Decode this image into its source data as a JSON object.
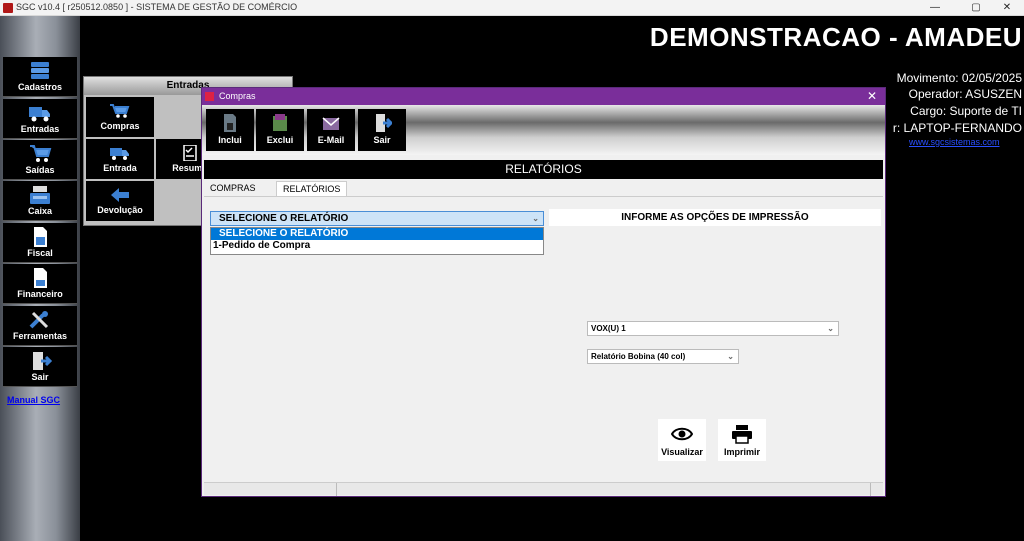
{
  "window": {
    "title": "SGC v10.4 [ r250512.0850 ] - SISTEMA DE GESTÃO DE COMÉRCIO",
    "minimize": "—",
    "maximize": "▢",
    "close": "✕"
  },
  "sidebar": {
    "items": [
      {
        "label": "Cadastros",
        "icon": "database-icon"
      },
      {
        "label": "Entradas",
        "icon": "truck-icon"
      },
      {
        "label": "Saídas",
        "icon": "cart-icon"
      },
      {
        "label": "Caixa",
        "icon": "cash-register-icon"
      },
      {
        "label": "Fiscal",
        "icon": "document-icon"
      },
      {
        "label": "Financeiro",
        "icon": "money-document-icon"
      },
      {
        "label": "Ferramentas",
        "icon": "tools-icon"
      },
      {
        "label": "Sair",
        "icon": "exit-icon"
      }
    ],
    "manual_link": "Manual SGC"
  },
  "header": {
    "company": "DEMONSTRACAO - AMADEU",
    "movimento": "Movimento: 02/05/2025",
    "operador": "Operador: ASUSZEN",
    "cargo": "Cargo: Suporte de TI",
    "terminal": "r: LAPTOP-FERNANDO",
    "site": "www.sgcsistemas.com"
  },
  "entradas_panel": {
    "title": "Entradas",
    "tiles": [
      {
        "label": "Compras",
        "icon": "cart-down-icon"
      },
      {
        "label": "Entrada",
        "icon": "truck-icon"
      },
      {
        "label": "Resumo",
        "icon": "checklist-icon"
      },
      {
        "label": "Devolução",
        "icon": "return-arrow-icon"
      }
    ]
  },
  "compras": {
    "title": "Compras",
    "close": "✕",
    "toolbar": [
      {
        "label": "Inclui",
        "icon": "add-document-icon"
      },
      {
        "label": "Exclui",
        "icon": "delete-book-icon"
      },
      {
        "label": "E-Mail",
        "icon": "email-icon"
      },
      {
        "label": "Sair",
        "icon": "exit-icon"
      }
    ],
    "section_title": "RELATÓRIOS",
    "tabs": [
      {
        "label": "COMPRAS",
        "active": false
      },
      {
        "label": "RELATÓRIOS",
        "active": true
      }
    ],
    "report_select": {
      "value": "SELECIONE O RELATÓRIO",
      "options": [
        "SELECIONE O RELATÓRIO",
        "1-Pedido de Compra"
      ]
    },
    "print_options_title": "INFORME AS OPÇÕES DE IMPRESSÃO",
    "printer_select": "VOX(U) 1",
    "format_select": "Relatório Bobina (40 col)",
    "actions": [
      {
        "label": "Visualizar",
        "icon": "eye-icon"
      },
      {
        "label": "Imprimir",
        "icon": "printer-icon"
      }
    ]
  }
}
